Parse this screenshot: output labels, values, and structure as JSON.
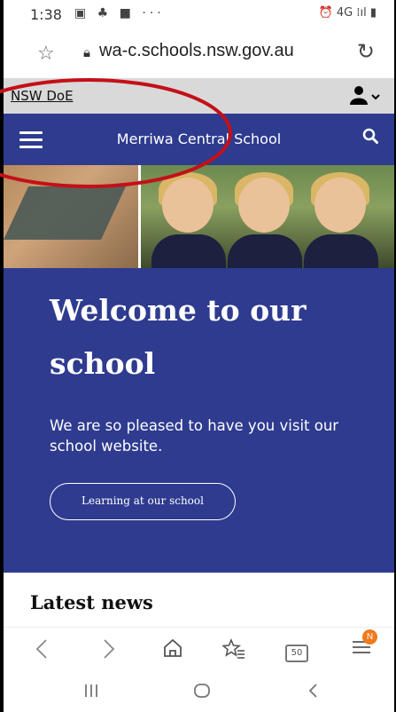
{
  "status": {
    "time": "1:38",
    "left_icons": "▣ ♣ ■ ···",
    "right_icons": "⏰ 4G ⁞ıl ▮"
  },
  "browser": {
    "url": "wa-c.schools.nsw.gov.au"
  },
  "utility": {
    "doe_link": "NSW DoE",
    "account_icon": "user-icon"
  },
  "header": {
    "site_title": "Merriwa Central School"
  },
  "welcome": {
    "heading": "Welcome to our school",
    "body": "We are so pleased to have you visit our school website.",
    "button": "Learning at our school"
  },
  "news": {
    "heading": "Latest news"
  },
  "toolbar": {
    "tabs_count": "50",
    "badge": "N"
  },
  "colors": {
    "brand_navy": "#2e3b8f",
    "annotation_red": "#c41019",
    "badge_orange": "#f07a1e"
  }
}
